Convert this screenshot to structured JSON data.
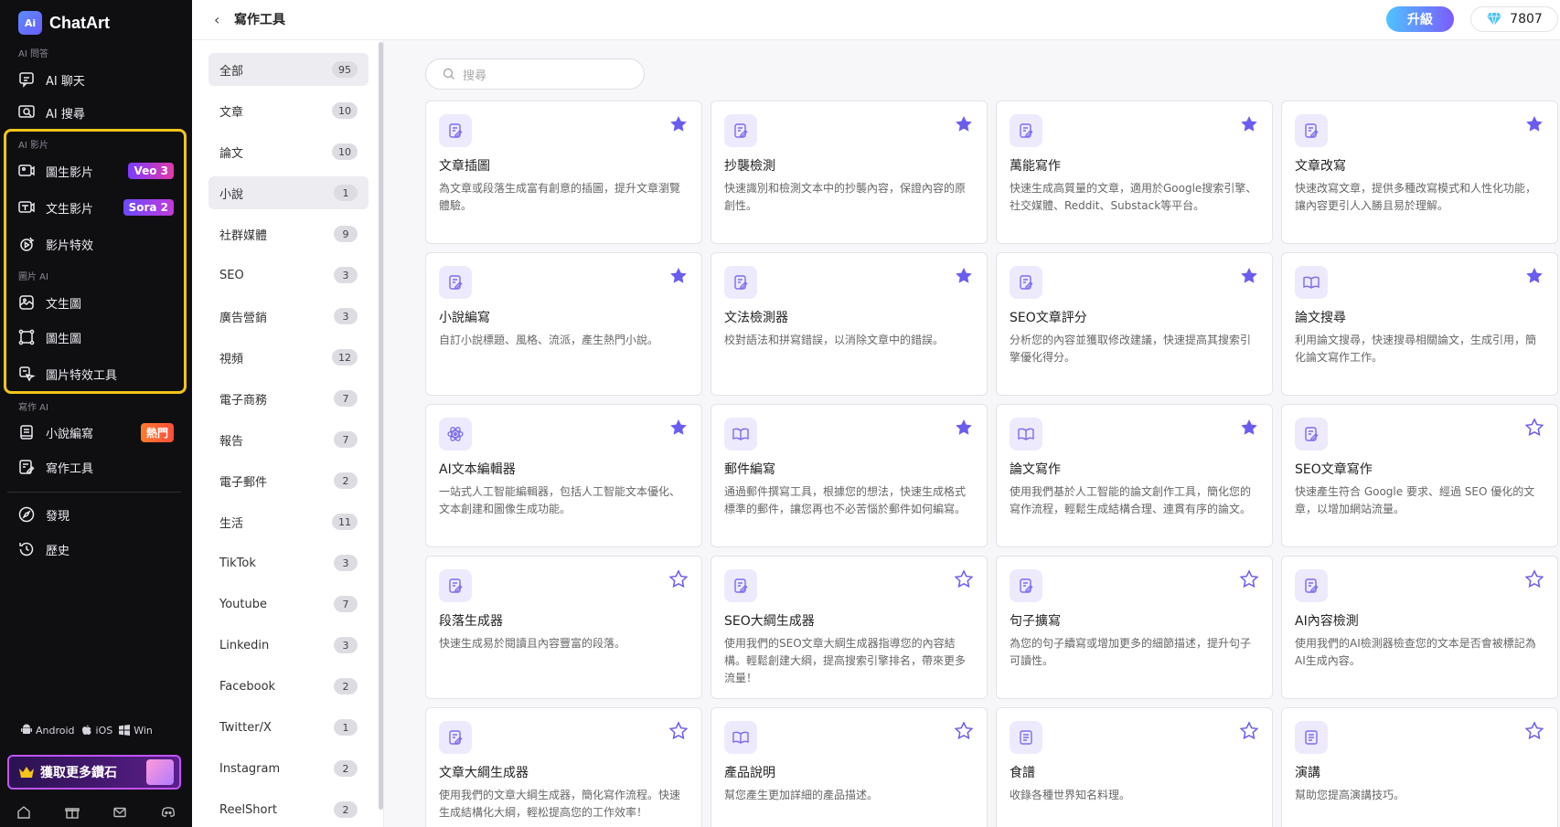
{
  "brand": {
    "name": "ChatArt",
    "logo_text": "Ai"
  },
  "sidebar": {
    "sections": [
      {
        "label": "AI 問答",
        "items": [
          {
            "label": "AI 聊天",
            "icon": "chat-icon"
          },
          {
            "label": "AI 搜尋",
            "icon": "search-window-icon"
          }
        ]
      },
      {
        "label": "AI 影片",
        "items": [
          {
            "label": "圖生影片",
            "icon": "image-video-icon",
            "badge": "Veo 3"
          },
          {
            "label": "文生影片",
            "icon": "text-video-icon",
            "badge": "Sora 2"
          },
          {
            "label": "影片特效",
            "icon": "video-effect-icon"
          }
        ]
      },
      {
        "label": "圖片 AI",
        "items": [
          {
            "label": "文生圖",
            "icon": "image-icon"
          },
          {
            "label": "圖生圖",
            "icon": "crop-icon"
          },
          {
            "label": "圖片特效工具",
            "icon": "image-effect-icon"
          }
        ]
      },
      {
        "label": "寫作 AI",
        "items": [
          {
            "label": "小說編寫",
            "icon": "book-icon",
            "badge": "熱門"
          },
          {
            "label": "寫作工具",
            "icon": "edit-icon"
          }
        ]
      }
    ],
    "extra": [
      {
        "label": "發現",
        "icon": "compass-icon"
      },
      {
        "label": "歷史",
        "icon": "history-icon"
      }
    ],
    "platforms": [
      "Android",
      "iOS",
      "Win"
    ],
    "promo": "獲取更多鑽石"
  },
  "topbar": {
    "title": "寫作工具",
    "upgrade": "升級",
    "gems": "7807"
  },
  "search": {
    "placeholder": "搜尋"
  },
  "categories": [
    {
      "label": "全部",
      "count": "95"
    },
    {
      "label": "文章",
      "count": "10"
    },
    {
      "label": "論文",
      "count": "10"
    },
    {
      "label": "小說",
      "count": "1"
    },
    {
      "label": "社群媒體",
      "count": "9"
    },
    {
      "label": "SEO",
      "count": "3"
    },
    {
      "label": "廣告營銷",
      "count": "3"
    },
    {
      "label": "視頻",
      "count": "12"
    },
    {
      "label": "電子商務",
      "count": "7"
    },
    {
      "label": "報告",
      "count": "7"
    },
    {
      "label": "電子郵件",
      "count": "2"
    },
    {
      "label": "生活",
      "count": "11"
    },
    {
      "label": "TikTok",
      "count": "3"
    },
    {
      "label": "Youtube",
      "count": "7"
    },
    {
      "label": "Linkedin",
      "count": "3"
    },
    {
      "label": "Facebook",
      "count": "2"
    },
    {
      "label": "Twitter/X",
      "count": "1"
    },
    {
      "label": "Instagram",
      "count": "2"
    },
    {
      "label": "ReelShort",
      "count": "2"
    }
  ],
  "cards": [
    {
      "title": "文章插圖",
      "desc": "為文章或段落生成富有創意的插圖，提升文章瀏覽體驗。",
      "icon": "edit-doc-icon",
      "starred": true
    },
    {
      "title": "抄襲檢測",
      "desc": "快速識別和檢測文本中的抄襲內容，保證內容的原創性。",
      "icon": "edit-doc-icon",
      "starred": true
    },
    {
      "title": "萬能寫作",
      "desc": "快速生成高質量的文章，適用於Google搜索引擎、社交媒體、Reddit、Substack等平台。",
      "icon": "edit-doc-icon",
      "starred": true
    },
    {
      "title": "文章改寫",
      "desc": "快速改寫文章，提供多種改寫模式和人性化功能，讓內容更引人入勝且易於理解。",
      "icon": "edit-doc-icon",
      "starred": true
    },
    {
      "title": "小說編寫",
      "desc": "自訂小說標題、風格、流派，產生熱門小說。",
      "icon": "edit-doc-icon",
      "starred": true
    },
    {
      "title": "文法檢測器",
      "desc": "校對語法和拼寫錯誤，以消除文章中的錯誤。",
      "icon": "edit-doc-icon",
      "starred": true
    },
    {
      "title": "SEO文章評分",
      "desc": "分析您的內容並獲取修改建議，快速提高其搜索引擎優化得分。",
      "icon": "edit-doc-icon",
      "starred": true
    },
    {
      "title": "論文搜尋",
      "desc": "利用論文搜尋，快速搜尋相關論文，生成引用，簡化論文寫作工作。",
      "icon": "open-book-icon",
      "starred": true
    },
    {
      "title": "AI文本編輯器",
      "desc": "一站式人工智能編輯器，包括人工智能文本優化、文本創建和圖像生成功能。",
      "icon": "atom-icon",
      "starred": true
    },
    {
      "title": "郵件編寫",
      "desc": "通過郵件撰寫工具，根據您的想法，快速生成格式標準的郵件，讓您再也不必苦惱於郵件如何編寫。",
      "icon": "open-book-icon",
      "starred": true
    },
    {
      "title": "論文寫作",
      "desc": "使用我們基於人工智能的論文創作工具，簡化您的寫作流程，輕鬆生成結構合理、連貫有序的論文。",
      "icon": "open-book-icon",
      "starred": true
    },
    {
      "title": "SEO文章寫作",
      "desc": "快速產生符合 Google 要求、經過 SEO 優化的文章，以增加網站流量。",
      "icon": "edit-doc-icon",
      "starred": false
    },
    {
      "title": "段落生成器",
      "desc": "快速生成易於閱讀且內容豐富的段落。",
      "icon": "edit-doc-icon",
      "starred": false
    },
    {
      "title": "SEO大綱生成器",
      "desc": "使用我們的SEO文章大綱生成器指導您的內容結構。輕鬆創建大綱，提高搜索引擎排名，帶來更多流量！",
      "icon": "edit-doc-icon",
      "starred": false
    },
    {
      "title": "句子擴寫",
      "desc": "為您的句子續寫或增加更多的細節描述，提升句子可讀性。",
      "icon": "edit-doc-icon",
      "starred": false
    },
    {
      "title": "AI內容檢測",
      "desc": "使用我們的AI檢測器檢查您的文本是否會被標記為AI生成內容。",
      "icon": "edit-doc-icon",
      "starred": false
    },
    {
      "title": "文章大綱生成器",
      "desc": "使用我們的文章大綱生成器，簡化寫作流程。快速生成結構化大綱，輕松提高您的工作效率！",
      "icon": "edit-doc-icon",
      "starred": false
    },
    {
      "title": "產品說明",
      "desc": "幫您產生更加詳細的產品描述。",
      "icon": "open-book-icon",
      "starred": false
    },
    {
      "title": "食譜",
      "desc": "收錄各種世界知名料理。",
      "icon": "doc-list-icon",
      "starred": false
    },
    {
      "title": "演講",
      "desc": "幫助您提高演講技巧。",
      "icon": "doc-list-icon",
      "starred": false
    }
  ],
  "colors": {
    "accent": "#6b5cf0",
    "icon_bg": "#eeeafd",
    "highlight": "#f5c518",
    "sidebar_bg": "#0f0f12"
  }
}
